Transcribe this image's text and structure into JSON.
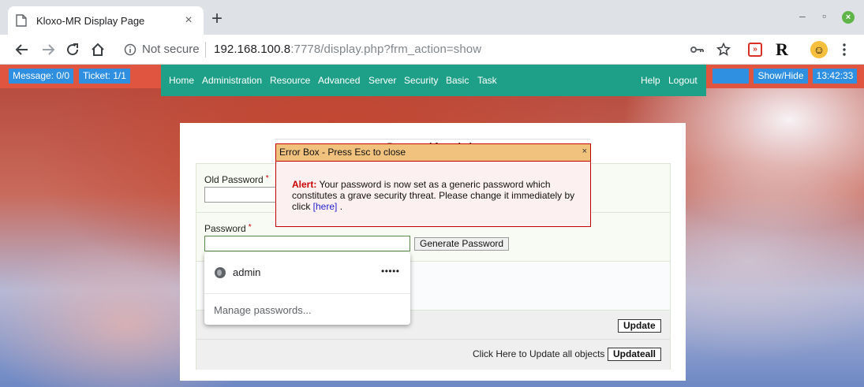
{
  "browser": {
    "tab_title": "Kloxo-MR Display Page",
    "tab_close": "×",
    "new_tab": "+",
    "security_label": "Not secure",
    "url_host": "192.168.100.8",
    "url_rest": ":7778/display.php?frm_action=show",
    "window_minimize": "‒",
    "window_maximize": "▫",
    "window_close": "×"
  },
  "topbar": {
    "message": "Message: 0/0",
    "ticket": "Ticket: 1/1",
    "show_hide": "Show/Hide",
    "clock": "13:42:33"
  },
  "nav": {
    "items": [
      "Home",
      "Administration",
      "Resource",
      "Advanced",
      "Server",
      "Security",
      "Basic",
      "Task"
    ],
    "right": [
      "Help",
      "Logout"
    ]
  },
  "form": {
    "title": "Password for admin",
    "old_password_label": "Old Password",
    "password_label": "Password",
    "generate_button": "Generate Password",
    "update_button": "Update",
    "update_all_text": "Click Here to Update all objects",
    "update_all_button": "Updateall"
  },
  "autofill": {
    "username": "admin",
    "password_mask": "•••••",
    "manage": "Manage passwords..."
  },
  "error_box": {
    "title": "Error Box - Press Esc to close",
    "close": "×",
    "alert_label": "Alert:",
    "message": " Your password is now set as a generic password which constitutes a grave security threat. Please change it immediately by click ",
    "link_text": "[here]",
    "message_end": " ."
  },
  "colors": {
    "topbar": "#e0553f",
    "nav": "#1ea088",
    "chip": "#2f8fe0",
    "error_border": "#c00000",
    "error_header": "#f0c27e"
  }
}
